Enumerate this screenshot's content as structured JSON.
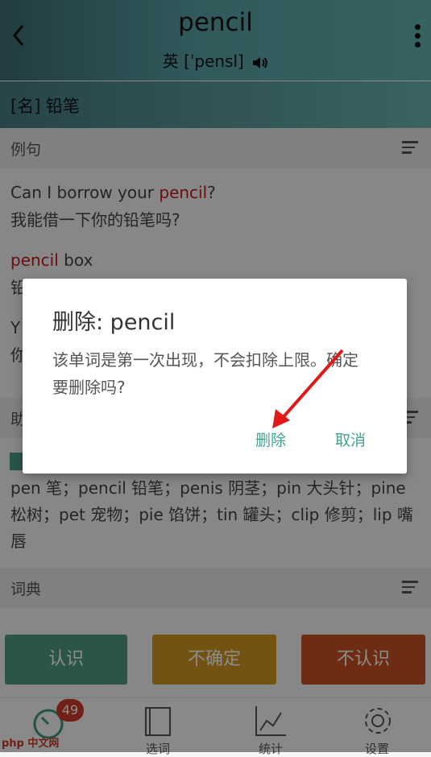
{
  "header": {
    "word": "pencil",
    "phonetic": "英 [ˈpensl]"
  },
  "definition": "[名] 铅笔",
  "sections": {
    "examples": "例句",
    "memory": "助",
    "dictionary": "词典"
  },
  "examples": [
    {
      "en_pre": "Can I borrow your ",
      "en_hl": "pencil",
      "en_post": "?",
      "zh": "我能借一下你的铅笔吗?"
    },
    {
      "en_pre": "",
      "en_hl": "pencil",
      "en_post": " box",
      "zh": "铅"
    },
    {
      "en_pre": "Y",
      "en_hl": "",
      "en_post": "",
      "zh": "你"
    }
  ],
  "similar_words": "pen 笔；pencil 铅笔；penis 阴茎；pin 大头针；pine 松树；pet 宠物；pie 馅饼；tin 罐头；clip 修剪；lip 嘴唇",
  "dialog": {
    "title": "删除: pencil",
    "message": "该单词是第一次出现，不会扣除上限。确定要删除吗?",
    "delete_label": "删除",
    "cancel_label": "取消"
  },
  "actions": {
    "know": "认识",
    "unsure": "不确定",
    "unknown": "不认识"
  },
  "action_colors": {
    "know": "#4f9c86",
    "unsure": "#d29820",
    "unknown": "#c85024"
  },
  "tabs": {
    "review_badge": "49",
    "select": "选词",
    "stats": "统计",
    "settings": "设置"
  },
  "watermark": "php 中文网"
}
